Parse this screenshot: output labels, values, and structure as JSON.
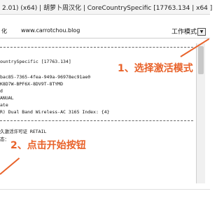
{
  "window": {
    "title": "2.01) (x64) | 胡萝卜周汉化 | CoreCountrySpecific [17763.134 | x64 ]"
  },
  "menu": {
    "left_item": "化",
    "url": "www.carrotchou.blog",
    "mode_label": "工作模式",
    "dropdown_icon": "dropdown-arrow-icon"
  },
  "log": [
    "ountrySpecific [17763.134]",
    "",
    "bac85-7365-4fea-949a-96978ec91ae0",
    "K8D7W-BPF6X-8DV9T-8TYMD",
    "d",
    "ANUAL",
    "ate",
    "R) Dual Band Wireless-AC 3165 Index: {4}",
    "",
    "久激活许可证 RETAIL",
    "态："
  ],
  "callouts": {
    "step1": "1、选择激活模式",
    "step2": "2、点击开始按钮"
  },
  "colors": {
    "accent": "#e8622a"
  }
}
